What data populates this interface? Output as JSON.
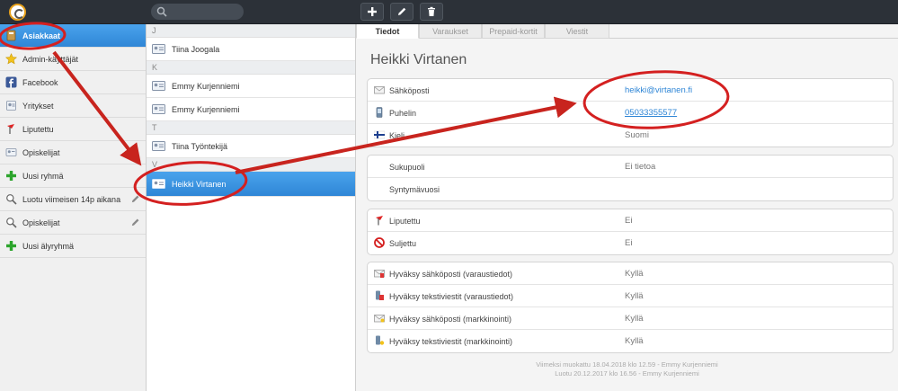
{
  "search": {
    "placeholder": ""
  },
  "toolbar": {
    "add_icon": "plus-icon",
    "edit_icon": "pencil-icon",
    "delete_icon": "trash-icon"
  },
  "sidebar": {
    "items": [
      {
        "label": "Asiakkaat",
        "icon": "address-book-icon"
      },
      {
        "label": "Admin-käyttäjät",
        "icon": "star-icon"
      },
      {
        "label": "Facebook",
        "icon": "facebook-icon"
      },
      {
        "label": "Yritykset",
        "icon": "building-icon"
      },
      {
        "label": "Liputettu",
        "icon": "flag-icon"
      },
      {
        "label": "Opiskelijat",
        "icon": "card-icon"
      },
      {
        "label": "Uusi ryhmä",
        "icon": "plus-icon"
      },
      {
        "label": "Luotu viimeisen 14p aikana",
        "icon": "search-icon"
      },
      {
        "label": "Opiskelijat",
        "icon": "search-icon"
      },
      {
        "label": "Uusi älyryhmä",
        "icon": "plus-icon"
      }
    ]
  },
  "contacts": {
    "groups": [
      {
        "letter": "J",
        "items": [
          "Tiina Joogala"
        ]
      },
      {
        "letter": "K",
        "items": [
          "Emmy Kurjenniemi",
          "Emmy Kurjenniemi"
        ]
      },
      {
        "letter": "T",
        "items": [
          "Tiina Työntekijä"
        ]
      },
      {
        "letter": "V",
        "items": [
          "Heikki Virtanen"
        ]
      }
    ]
  },
  "tabs": [
    "Tiedot",
    "Varaukset",
    "Prepaid-kortit",
    "Viestit"
  ],
  "detail": {
    "name": "Heikki Virtanen",
    "contact": [
      {
        "label": "Sähköposti",
        "value": "heikki@virtanen.fi"
      },
      {
        "label": "Puhelin",
        "value": "05033355577"
      },
      {
        "label": "Kieli",
        "value": "Suomi"
      }
    ],
    "personal": [
      {
        "label": "Sukupuoli",
        "value": "Ei tietoa"
      },
      {
        "label": "Syntymävuosi",
        "value": ""
      }
    ],
    "status": [
      {
        "label": "Liputettu",
        "value": "Ei"
      },
      {
        "label": "Suljettu",
        "value": "Ei"
      }
    ],
    "consents": [
      {
        "label": "Hyväksy sähköposti (varaustiedot)",
        "value": "Kyllä"
      },
      {
        "label": "Hyväksy tekstiviestit (varaustiedot)",
        "value": "Kyllä"
      },
      {
        "label": "Hyväksy sähköposti (markkinointi)",
        "value": "Kyllä"
      },
      {
        "label": "Hyväksy tekstiviestit (markkinointi)",
        "value": "Kyllä"
      }
    ],
    "modified": "Viimeksi muokattu 18.04.2018 klo 12.59 - Emmy Kurjenniemi",
    "created": "Luotu 20.12.2017 klo 16.56 - Emmy Kurjenniemi"
  },
  "colors": {
    "accent": "#2f86d6",
    "annotation": "#d42020",
    "topbar": "#2c3138"
  }
}
